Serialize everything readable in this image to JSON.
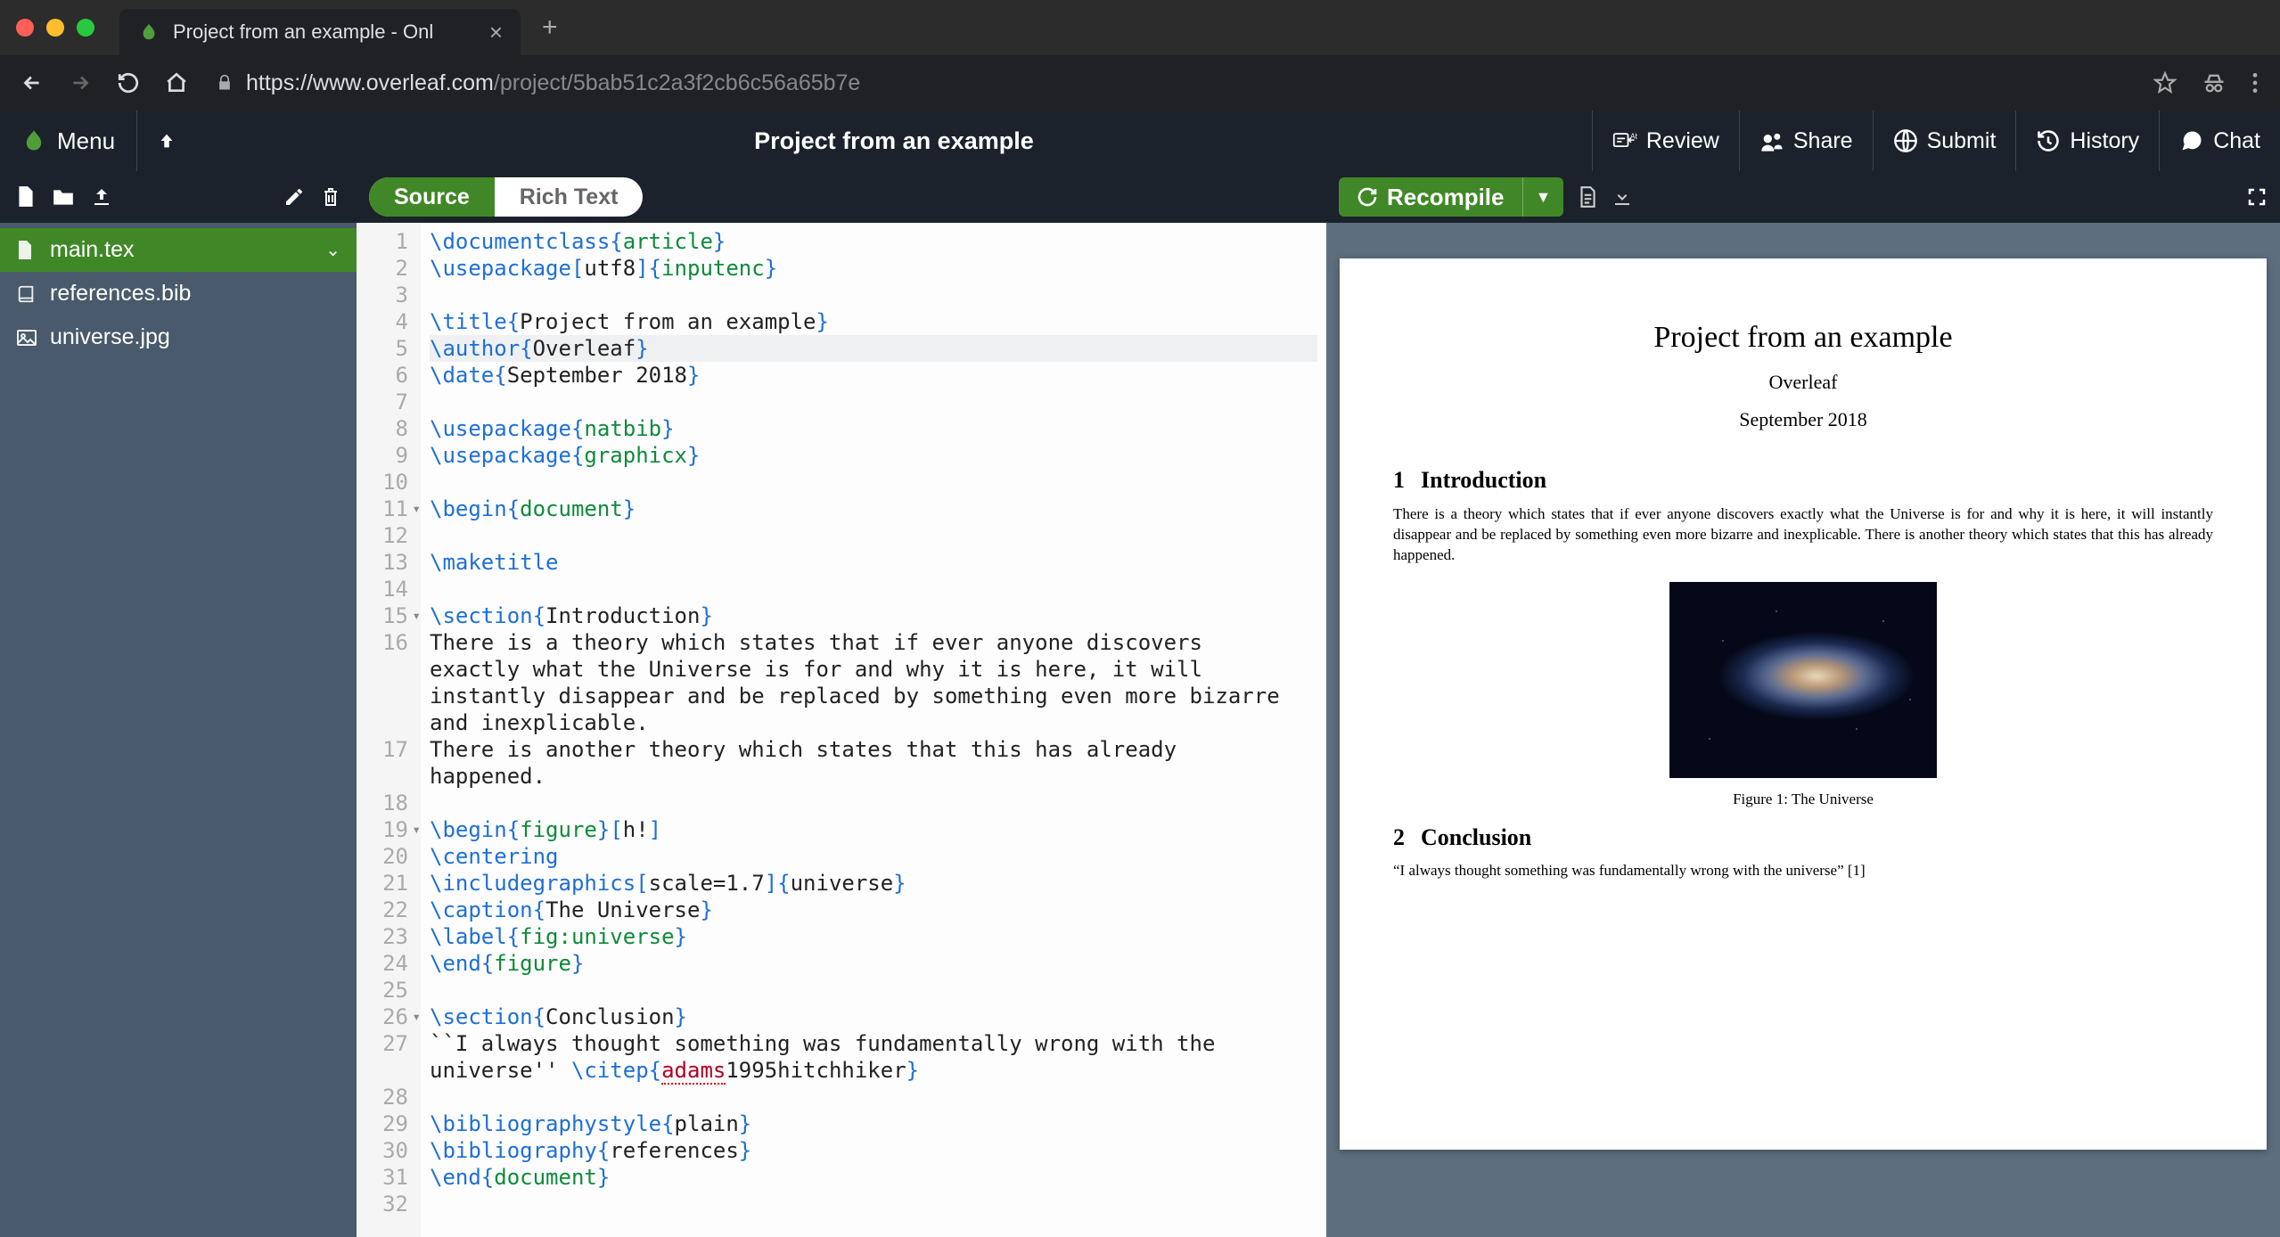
{
  "browser": {
    "tab_title": "Project from an example - Onl",
    "url_secure": "https://www.overleaf.com",
    "url_path": "/project/5bab51c2a3f2cb6c56a65b7e"
  },
  "header": {
    "menu": "Menu",
    "project_title": "Project from an example",
    "actions": {
      "review": "Review",
      "share": "Share",
      "submit": "Submit",
      "history": "History",
      "chat": "Chat"
    }
  },
  "file_tree": {
    "items": [
      {
        "name": "main.tex",
        "icon": "file",
        "active": true
      },
      {
        "name": "references.bib",
        "icon": "book",
        "active": false
      },
      {
        "name": "universe.jpg",
        "icon": "image",
        "active": false
      }
    ]
  },
  "editor_tabs": {
    "source": "Source",
    "richtext": "Rich Text"
  },
  "recompile": {
    "label": "Recompile"
  },
  "code_lines": [
    {
      "n": 1,
      "html": "<span class='cm'>\\documentclass</span><span class='br'>{</span><span class='kw'>article</span><span class='br'>}</span>"
    },
    {
      "n": 2,
      "html": "<span class='cm'>\\usepackage</span><span class='op'>[</span>utf8<span class='op'>]</span><span class='br'>{</span><span class='kw'>inputenc</span><span class='br'>}</span>"
    },
    {
      "n": 3,
      "html": ""
    },
    {
      "n": 4,
      "html": "<span class='cm'>\\title</span><span class='br'>{</span>Project from an example<span class='br'>}</span>"
    },
    {
      "n": 5,
      "html": "<span class='cm'>\\author</span><span class='br'>{</span>Overleaf<span class='br'>}</span>",
      "hl": true
    },
    {
      "n": 6,
      "html": "<span class='cm'>\\date</span><span class='br'>{</span>September 2018<span class='br'>}</span>"
    },
    {
      "n": 7,
      "html": ""
    },
    {
      "n": 8,
      "html": "<span class='cm'>\\usepackage</span><span class='br'>{</span><span class='kw'>natbib</span><span class='br'>}</span>"
    },
    {
      "n": 9,
      "html": "<span class='cm'>\\usepackage</span><span class='br'>{</span><span class='kw'>graphicx</span><span class='br'>}</span>"
    },
    {
      "n": 10,
      "html": ""
    },
    {
      "n": 11,
      "html": "<span class='cm'>\\begin</span><span class='br'>{</span><span class='kw'>document</span><span class='br'>}</span>",
      "fold": true
    },
    {
      "n": 12,
      "html": ""
    },
    {
      "n": 13,
      "html": "<span class='cm'>\\maketitle</span>"
    },
    {
      "n": 14,
      "html": ""
    },
    {
      "n": 15,
      "html": "<span class='cm'>\\section</span><span class='br'>{</span>Introduction<span class='br'>}</span>",
      "fold": true
    },
    {
      "n": 16,
      "html": "There is a theory which states that if ever anyone discovers "
    },
    {
      "wrap": true,
      "html": "exactly what the Universe is for and why it is here, it will "
    },
    {
      "wrap": true,
      "html": "instantly disappear and be replaced by something even more bizarre "
    },
    {
      "wrap": true,
      "html": "and inexplicable."
    },
    {
      "n": 17,
      "html": "There is another theory which states that this has already "
    },
    {
      "wrap": true,
      "html": "happened."
    },
    {
      "n": 18,
      "html": ""
    },
    {
      "n": 19,
      "html": "<span class='cm'>\\begin</span><span class='br'>{</span><span class='kw'>figure</span><span class='br'>}</span><span class='op'>[</span>h!<span class='op'>]</span>",
      "fold": true
    },
    {
      "n": 20,
      "html": "<span class='cm'>\\centering</span>"
    },
    {
      "n": 21,
      "html": "<span class='cm'>\\includegraphics</span><span class='op'>[</span>scale=1.7<span class='op'>]</span><span class='br'>{</span>universe<span class='br'>}</span>"
    },
    {
      "n": 22,
      "html": "<span class='cm'>\\caption</span><span class='br'>{</span>The Universe<span class='br'>}</span>"
    },
    {
      "n": 23,
      "html": "<span class='cm'>\\label</span><span class='br'>{</span><span class='kw'>fig:universe</span><span class='br'>}</span>"
    },
    {
      "n": 24,
      "html": "<span class='cm'>\\end</span><span class='br'>{</span><span class='kw'>figure</span><span class='br'>}</span>"
    },
    {
      "n": 25,
      "html": ""
    },
    {
      "n": 26,
      "html": "<span class='cm'>\\section</span><span class='br'>{</span>Conclusion<span class='br'>}</span>",
      "fold": true
    },
    {
      "n": 27,
      "html": "``I always thought something was fundamentally wrong with the "
    },
    {
      "wrap": true,
      "html": "universe'' <span class='cm'>\\citep</span><span class='br'>{</span><span class='sp'>adams</span>1995hitchhiker<span class='br'>}</span>"
    },
    {
      "n": 28,
      "html": ""
    },
    {
      "n": 29,
      "html": "<span class='cm'>\\bibliographystyle</span><span class='br'>{</span>plain<span class='br'>}</span>"
    },
    {
      "n": 30,
      "html": "<span class='cm'>\\bibliography</span><span class='br'>{</span>references<span class='br'>}</span>"
    },
    {
      "n": 31,
      "html": "<span class='cm'>\\end</span><span class='br'>{</span><span class='kw'>document</span><span class='br'>}</span>"
    },
    {
      "n": 32,
      "html": ""
    }
  ],
  "pdf": {
    "title": "Project from an example",
    "author": "Overleaf",
    "date": "September 2018",
    "sec1_num": "1",
    "sec1_title": "Introduction",
    "para1": "There is a theory which states that if ever anyone discovers exactly what the Universe is for and why it is here, it will instantly disappear and be replaced by something even more bizarre and inexplicable. There is another theory which states that this has already happened.",
    "fig_caption": "Figure 1: The Universe",
    "sec2_num": "2",
    "sec2_title": "Conclusion",
    "quote": "“I always thought something was fundamentally wrong with the universe” [1]"
  }
}
